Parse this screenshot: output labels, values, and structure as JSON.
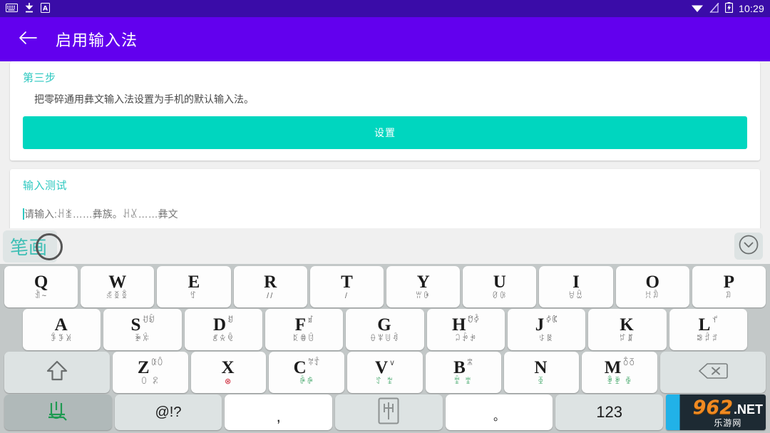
{
  "statusbar": {
    "time": "10:29",
    "left_icons": [
      "keyboard-icon",
      "download-icon",
      "app-a-icon"
    ],
    "right_icons": [
      "wifi-icon",
      "signal-off-icon",
      "battery-charging-icon"
    ]
  },
  "appbar": {
    "back_label": "返回",
    "title": "启用输入法"
  },
  "content": {
    "step_card": {
      "title": "第三步",
      "description": "把零碎通用彝文输入法设置为手机的默认输入法。",
      "button_label": "设置"
    },
    "test_card": {
      "title": "输入测试",
      "input_value": "",
      "input_placeholder": "请输入:ꃅꁧ……彝族。ꃅꊪ……彝文"
    }
  },
  "keyboard": {
    "candidate_bar": {
      "candidate": "笔画",
      "collapse_icon": "chevron-down-icon"
    },
    "row1": [
      {
        "letter": "Q",
        "sub": "ꀉ~",
        "side": ""
      },
      {
        "letter": "W",
        "sub": "ꅇꅉꅈ",
        "side": ""
      },
      {
        "letter": "E",
        "sub": "ꉐ",
        "side": ""
      },
      {
        "letter": "R",
        "sub": "//",
        "side": ""
      },
      {
        "letter": "T",
        "sub": "/",
        "side": ""
      },
      {
        "letter": "Y",
        "sub": "ꀕꀖ",
        "side": ""
      },
      {
        "letter": "U",
        "sub": "ꀜꀝ",
        "side": ""
      },
      {
        "letter": "I",
        "sub": "ꀞꀟ",
        "side": ""
      },
      {
        "letter": "O",
        "sub": "ꀡꀢ",
        "side": ""
      },
      {
        "letter": "P",
        "sub": "ꀣ",
        "side": ""
      }
    ],
    "row2": [
      {
        "letter": "A",
        "sub": "ꊇꊈꊉ",
        "side": ""
      },
      {
        "letter": "S",
        "sub": "ꋘꋙ",
        "side": "ꀀꀁ"
      },
      {
        "letter": "D",
        "sub": "ꋝꋞꋟ",
        "side": "ꀂ"
      },
      {
        "letter": "F",
        "sub": "ꌅꌆꌇ",
        "side": "ꀃ"
      },
      {
        "letter": "G",
        "sub": "ꂷꂸꂹꂺ",
        "side": ""
      },
      {
        "letter": "H",
        "sub": "ꃀꃁꃂ",
        "side": "ꀄꀅ"
      },
      {
        "letter": "J",
        "sub": "ꃈꃉ",
        "side": "ꀆꀇ"
      },
      {
        "letter": "K",
        "sub": "ꃐꃑ",
        "side": ""
      },
      {
        "letter": "L",
        "sub": "ꄀꄁꄂ",
        "side": "ꀈ"
      }
    ],
    "row3": [
      {
        "type": "shift",
        "icon": "shift-up-arrow-icon"
      },
      {
        "letter": "Z",
        "sub": "ꄲ ꄳ",
        "side": "ꄰꄱ"
      },
      {
        "letter": "X",
        "sub": "⊗",
        "side": "",
        "sub_color": "red"
      },
      {
        "letter": "C",
        "sub": "ꄴꄵ",
        "side": "ꄶꄷ",
        "sub_color": "green"
      },
      {
        "letter": "V",
        "sub": "ꄸ ꄹ",
        "side": "∨",
        "sub_color": "green"
      },
      {
        "letter": "B",
        "sub": "ꄺ ꄻ",
        "side": "ꄼ",
        "sub_color": "green"
      },
      {
        "letter": "N",
        "sub": "ꄽ",
        "side": "",
        "sub_color": "green"
      },
      {
        "letter": "M",
        "sub": "ꄾꄿ ꅀ",
        "side": "ꅁꅂ",
        "sub_color": "green"
      },
      {
        "type": "backspace",
        "icon": "backspace-icon"
      }
    ],
    "row4": [
      {
        "type": "lang",
        "icon": "yi-script-green-icon",
        "state": "pressed"
      },
      {
        "type": "symbols",
        "label": "@!?"
      },
      {
        "type": "comma",
        "label": ","
      },
      {
        "type": "yi-mode",
        "icon": "yi-boxed-glyph-icon"
      },
      {
        "type": "period",
        "label": "。"
      },
      {
        "type": "numbers",
        "label": "123"
      },
      {
        "type": "logo",
        "text_main": "962",
        "text_net": ".NET",
        "text_cn": "乐游网"
      }
    ]
  },
  "colors": {
    "statusbar": "#3a0ca8",
    "appbar": "#6200ee",
    "accent_teal": "#00d6bf",
    "title_teal": "#2ec8c0",
    "keyboard_bg": "#c3c8c8",
    "key_bg": "#fdfdfd",
    "fn_key_bg": "#dde3e3"
  }
}
